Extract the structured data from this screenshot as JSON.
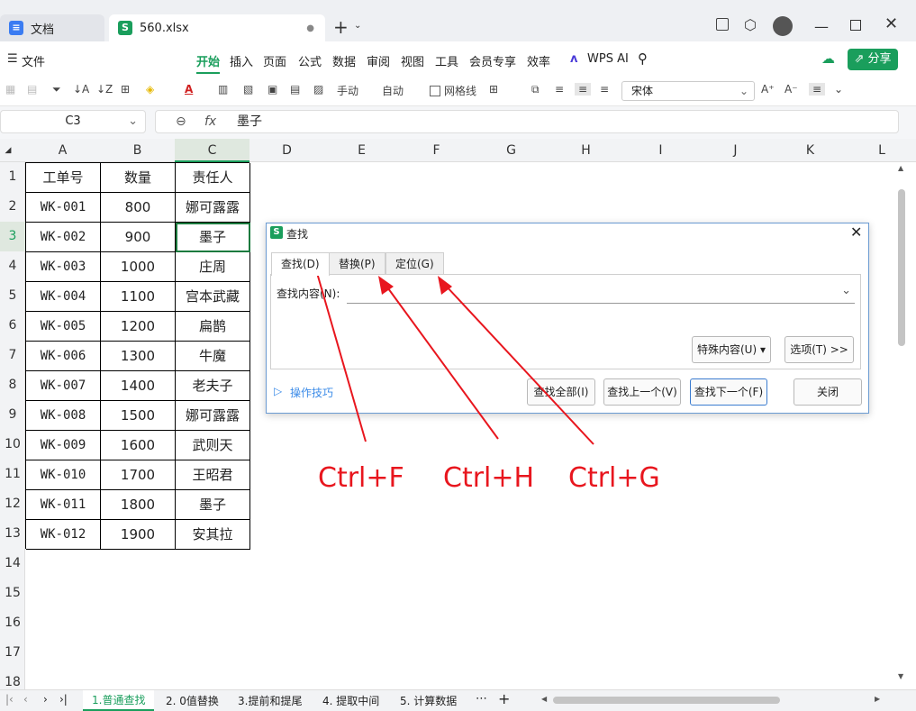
{
  "titlebar": {
    "tab_doc": "文档",
    "tab_file": "560.xlsx",
    "add_label": "+"
  },
  "menubar": {
    "file": "文件",
    "items": [
      "开始",
      "插入",
      "页面",
      "公式",
      "数据",
      "审阅",
      "视图",
      "工具",
      "会员专享",
      "效率"
    ],
    "wps_ai": "WPS AI",
    "share": "分享"
  },
  "toolbar": {
    "manual": "手动",
    "auto": "自动",
    "gridlines": "网格线",
    "font": "宋体"
  },
  "formulabar": {
    "cellref": "C3",
    "fx": "fx",
    "content": "墨子"
  },
  "columns": [
    "A",
    "B",
    "C",
    "D",
    "E",
    "F",
    "G",
    "H",
    "I",
    "J",
    "K",
    "L"
  ],
  "rows": [
    "1",
    "2",
    "3",
    "4",
    "5",
    "6",
    "7",
    "8",
    "9",
    "10",
    "11",
    "12",
    "13",
    "14",
    "15",
    "16",
    "17",
    "18"
  ],
  "table": {
    "header": [
      "工单号",
      "数量",
      "责任人"
    ],
    "data": [
      [
        "WK-001",
        "800",
        "娜可露露"
      ],
      [
        "WK-002",
        "900",
        "墨子"
      ],
      [
        "WK-003",
        "1000",
        "庄周"
      ],
      [
        "WK-004",
        "1100",
        "宫本武藏"
      ],
      [
        "WK-005",
        "1200",
        "扁鹊"
      ],
      [
        "WK-006",
        "1300",
        "牛魔"
      ],
      [
        "WK-007",
        "1400",
        "老夫子"
      ],
      [
        "WK-008",
        "1500",
        "娜可露露"
      ],
      [
        "WK-009",
        "1600",
        "武则天"
      ],
      [
        "WK-010",
        "1700",
        "王昭君"
      ],
      [
        "WK-011",
        "1800",
        "墨子"
      ],
      [
        "WK-012",
        "1900",
        "安其拉"
      ]
    ]
  },
  "dialog": {
    "title": "查找",
    "tabs": [
      "查找(D)",
      "替换(P)",
      "定位(G)"
    ],
    "find_label": "查找内容(N):",
    "special": "特殊内容(U)",
    "options": "选项(T) >>",
    "tips": "操作技巧",
    "find_all": "查找全部(I)",
    "find_prev": "查找上一个(V)",
    "find_next": "查找下一个(F)",
    "close": "关闭"
  },
  "annotations": [
    "Ctrl+F",
    "Ctrl+H",
    "Ctrl+G"
  ],
  "sheets": [
    "1.普通查找",
    "2. 0值替换",
    "3.提前和提尾",
    "4. 提取中间",
    "5. 计算数据"
  ],
  "colors": {
    "accent": "#1a9e5c",
    "annot": "#e8161e",
    "dialog_border": "#6b9bd2"
  }
}
